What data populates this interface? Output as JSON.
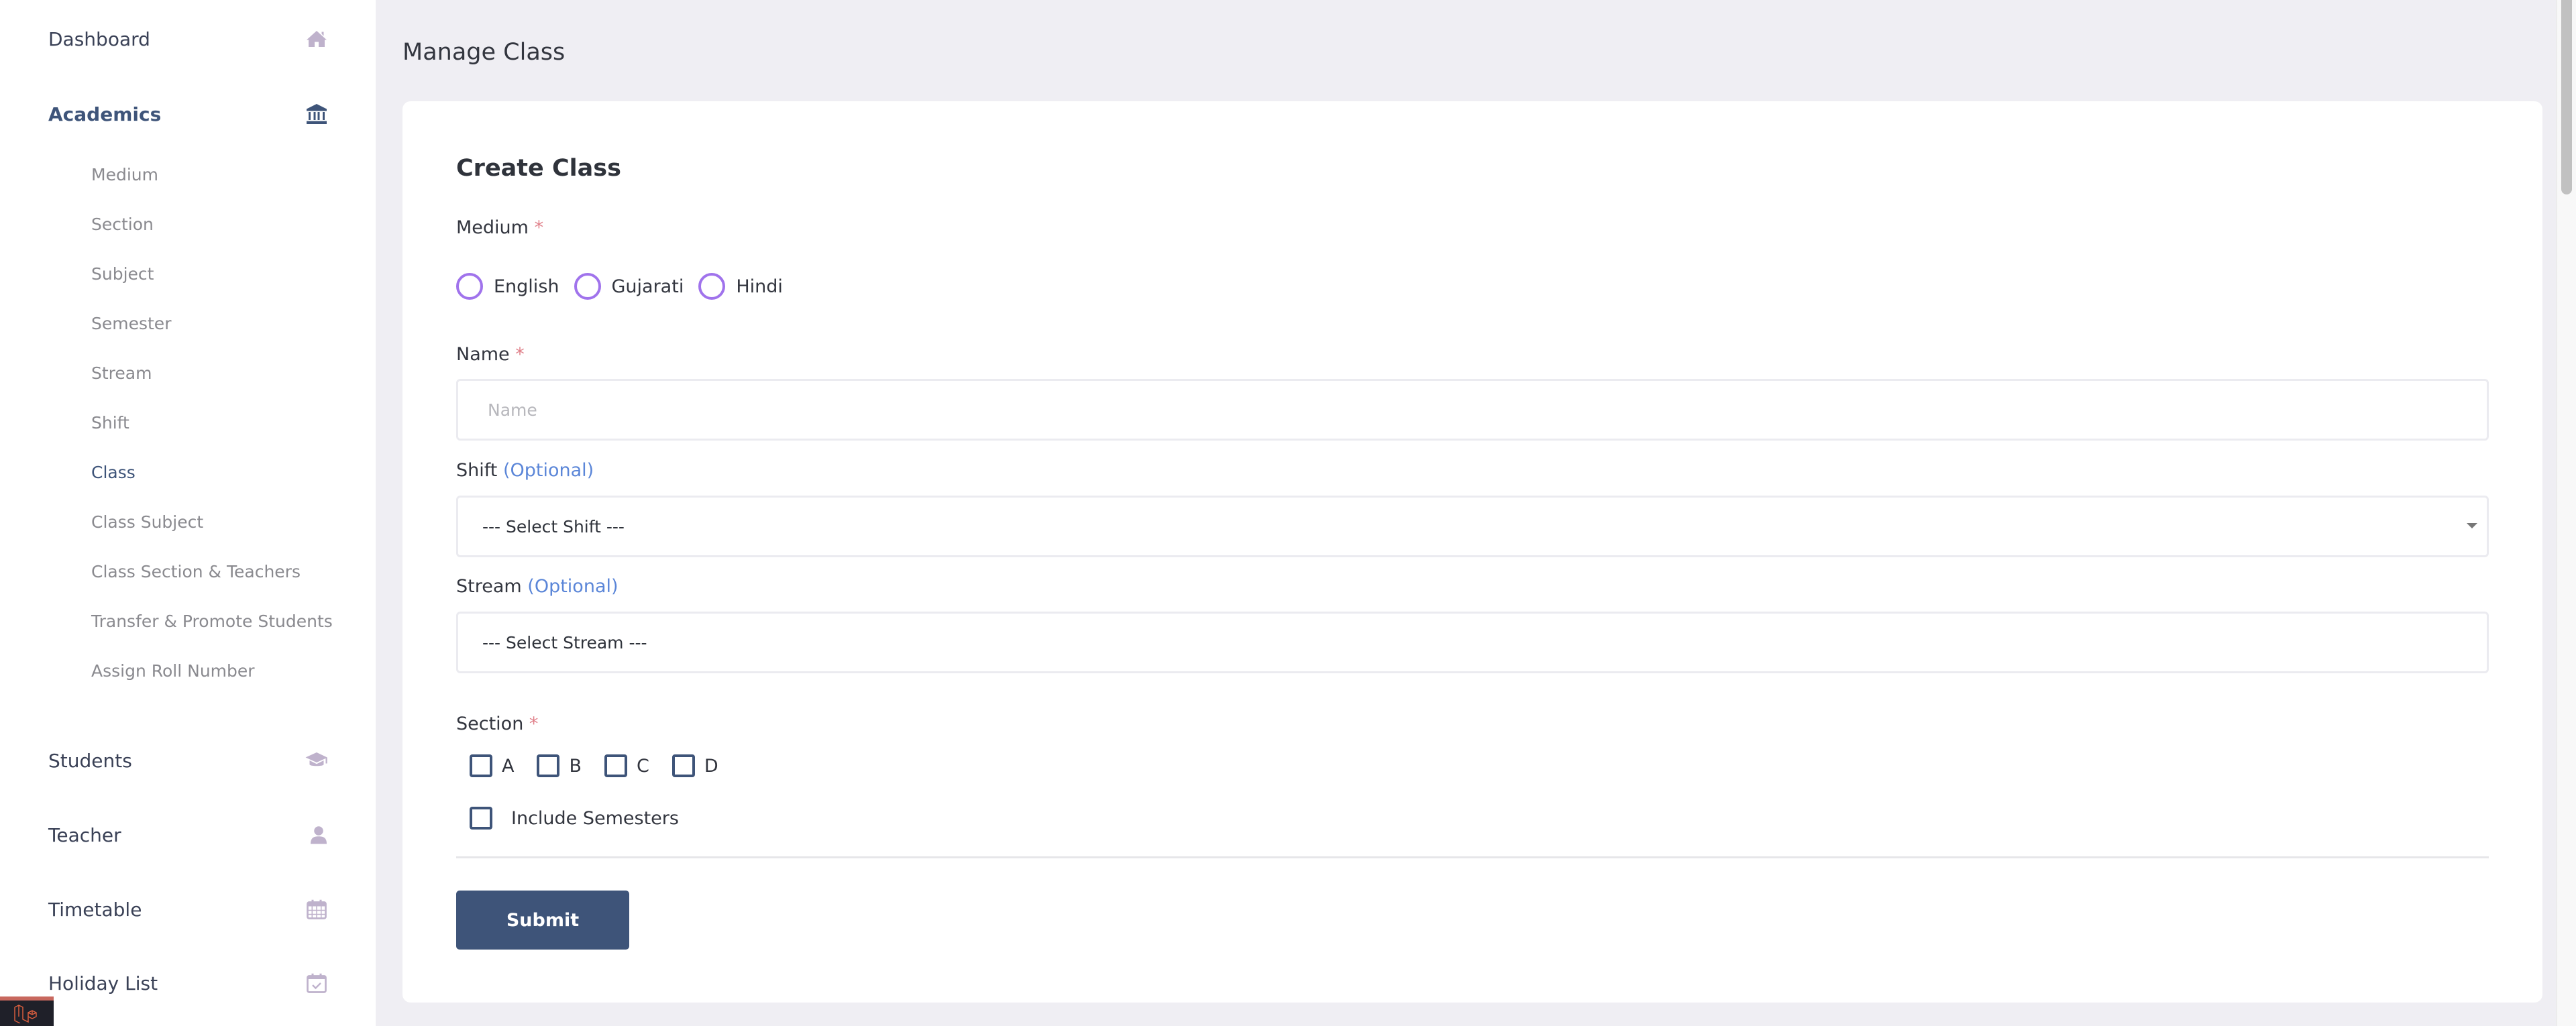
{
  "sidebar": {
    "items": [
      {
        "label": "Dashboard",
        "icon": "home-icon"
      },
      {
        "label": "Academics",
        "icon": "institution-icon",
        "active": true
      },
      {
        "label": "Students",
        "icon": "graduation-cap-icon"
      },
      {
        "label": "Teacher",
        "icon": "user-icon"
      },
      {
        "label": "Timetable",
        "icon": "calendar-icon"
      },
      {
        "label": "Holiday List",
        "icon": "calendar-check-icon"
      }
    ],
    "academics_sub": [
      "Medium",
      "Section",
      "Subject",
      "Semester",
      "Stream",
      "Shift",
      "Class",
      "Class Subject",
      "Class Section & Teachers",
      "Transfer & Promote Students",
      "Assign Roll Number"
    ],
    "active_sub": "Class"
  },
  "page": {
    "title": "Manage Class"
  },
  "form": {
    "title": "Create Class",
    "medium": {
      "label": "Medium",
      "required_mark": "*",
      "options": [
        "English",
        "Gujarati",
        "Hindi"
      ],
      "selected": null
    },
    "name": {
      "label": "Name",
      "required_mark": "*",
      "placeholder": "Name",
      "value": ""
    },
    "shift": {
      "label": "Shift",
      "optional_text": "(Optional)",
      "selected": "--- Select Shift ---"
    },
    "stream": {
      "label": "Stream",
      "optional_text": "(Optional)",
      "selected": "--- Select Stream ---"
    },
    "section": {
      "label": "Section",
      "required_mark": "*",
      "options": [
        "A",
        "B",
        "C",
        "D"
      ],
      "checked": []
    },
    "include_semesters": {
      "label": "Include Semesters",
      "checked": false
    },
    "submit_label": "Submit"
  },
  "colors": {
    "primary": "#3e5479",
    "radio_accent": "#a073ec",
    "required": "#e0808a",
    "optional": "#5b86d8",
    "icon_muted": "#bfb2cc",
    "debugbar_accent": "#c8685e"
  }
}
